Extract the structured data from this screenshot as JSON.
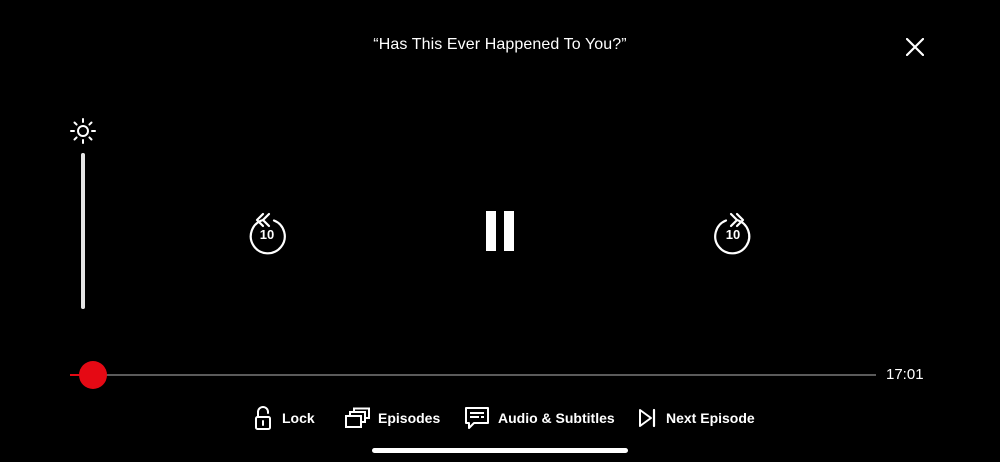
{
  "player": {
    "episode_title": "“Has This Ever Happened To You?”",
    "time_remaining": "17:01",
    "progress_fraction": 0.029,
    "brightness_fraction": 1.0,
    "accent_color": "#e50914"
  },
  "controls": {
    "rewind_seconds": "10",
    "forward_seconds": "10"
  },
  "bottom_bar": {
    "lock_label": "Lock",
    "episodes_label": "Episodes",
    "audio_label": "Audio & Subtitles",
    "next_label": "Next Episode"
  },
  "icons": [
    "close-icon",
    "brightness-icon",
    "rewind-10-icon",
    "pause-icon",
    "forward-10-icon",
    "lock-icon",
    "episodes-icon",
    "audio-subtitles-icon",
    "next-episode-icon"
  ]
}
